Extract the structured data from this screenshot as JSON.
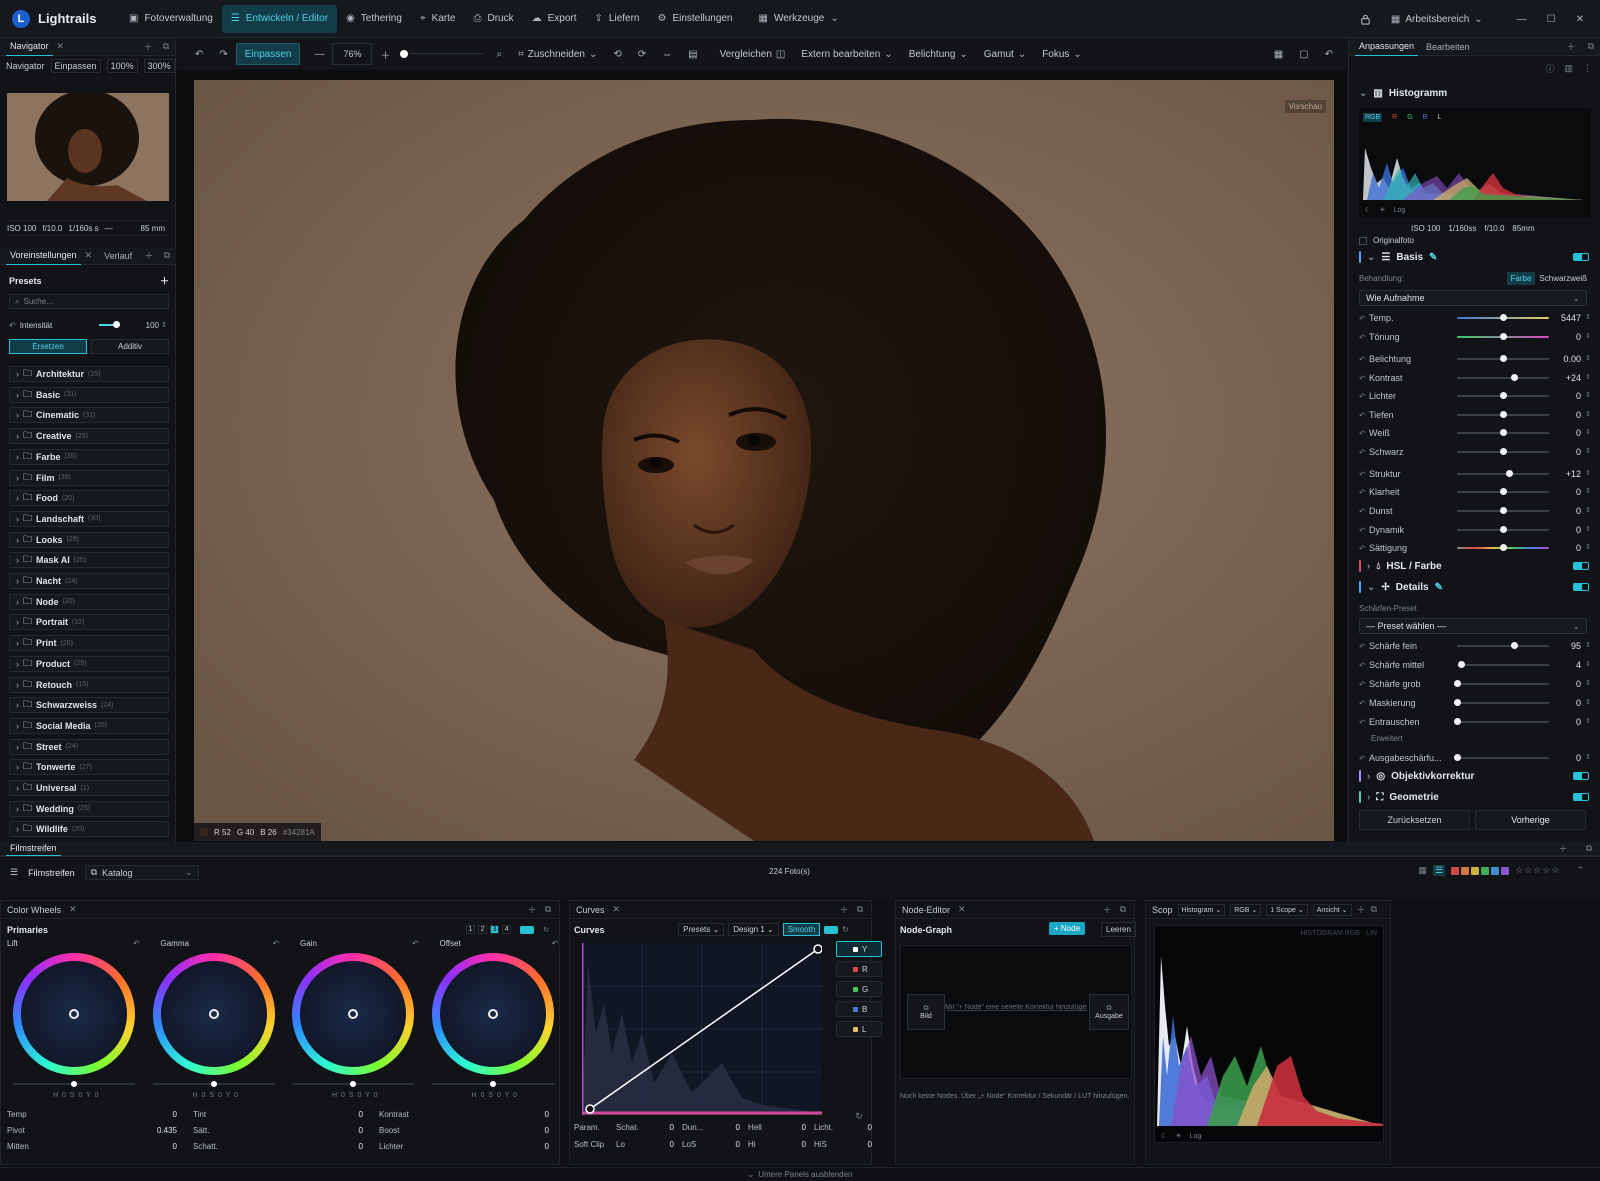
{
  "app": {
    "name": "Lightrails"
  },
  "topnav": [
    {
      "label": "Fotoverwaltung",
      "icon": "photos-icon",
      "active": false
    },
    {
      "label": "Entwickeln / Editor",
      "icon": "sliders-icon",
      "active": true
    },
    {
      "label": "Tethering",
      "icon": "camera-icon",
      "active": false
    },
    {
      "label": "Karte",
      "icon": "map-pin-icon",
      "active": false
    },
    {
      "label": "Druck",
      "icon": "printer-icon",
      "active": false
    },
    {
      "label": "Export",
      "icon": "cloud-upload-icon",
      "active": false
    },
    {
      "label": "Liefern",
      "icon": "upload-icon",
      "active": false
    },
    {
      "label": "Einstellungen",
      "icon": "gear-icon",
      "active": false
    },
    {
      "label": "Werkzeuge",
      "icon": "grid-icon",
      "active": false
    }
  ],
  "topright": {
    "workspace": "Arbeitsbereich"
  },
  "navigator": {
    "tab": "Navigator",
    "label": "Navigator",
    "fit": "Einpassen",
    "z100": "100%",
    "z300": "300%",
    "exif": [
      "ISO 100",
      "f/10.0",
      "1/160s s",
      "—",
      "85 mm"
    ]
  },
  "presets_panel": {
    "tab1": "Voreinstellungen",
    "tab2": "Verlauf",
    "title": "Presets",
    "search_placeholder": "Suche...",
    "intensity_label": "Intensität",
    "intensity_value": "100",
    "intensity": 1.0,
    "mode_replace": "Ersetzen",
    "mode_additive": "Additiv",
    "folders": [
      {
        "name": "Architektur",
        "count": "(25)"
      },
      {
        "name": "Basic",
        "count": "(31)"
      },
      {
        "name": "Cinematic",
        "count": "(31)"
      },
      {
        "name": "Creative",
        "count": "(25)"
      },
      {
        "name": "Farbe",
        "count": "(35)"
      },
      {
        "name": "Film",
        "count": "(39)"
      },
      {
        "name": "Food",
        "count": "(20)"
      },
      {
        "name": "Landschaft",
        "count": "(30)"
      },
      {
        "name": "Looks",
        "count": "(29)"
      },
      {
        "name": "Mask AI",
        "count": "(25)"
      },
      {
        "name": "Nacht",
        "count": "(24)"
      },
      {
        "name": "Node",
        "count": "(20)"
      },
      {
        "name": "Portrait",
        "count": "(32)"
      },
      {
        "name": "Print",
        "count": "(20)"
      },
      {
        "name": "Product",
        "count": "(25)"
      },
      {
        "name": "Retouch",
        "count": "(15)"
      },
      {
        "name": "Schwarzweiss",
        "count": "(24)"
      },
      {
        "name": "Social Media",
        "count": "(20)"
      },
      {
        "name": "Street",
        "count": "(24)"
      },
      {
        "name": "Tonwerte",
        "count": "(27)"
      },
      {
        "name": "Universal",
        "count": "(1)"
      },
      {
        "name": "Wedding",
        "count": "(25)"
      },
      {
        "name": "Wildlife",
        "count": "(20)"
      }
    ]
  },
  "toolbar": {
    "fit": "Einpassen",
    "zoom": "76%",
    "crop": "Zuschneiden",
    "compare": "Vergleichen",
    "external": "Extern bearbeiten",
    "exposure": "Belichtung",
    "gamut": "Gamut",
    "focus": "Fokus"
  },
  "viewer": {
    "preview_badge": "Vorschau",
    "pixel_readout": {
      "r": "R 52",
      "g": "G 40",
      "b": "B 26",
      "hex": "#34281A"
    }
  },
  "right_panel": {
    "tab1": "Anpassungen",
    "tab2": "Bearbeiten",
    "histogram_title": "Histogramm",
    "hist_channels": [
      "RGB",
      "R",
      "G",
      "B",
      "L"
    ],
    "hist_log": "Log",
    "exif_line": [
      "ISO 100",
      "1/160ss",
      "f/10.0",
      "85mm"
    ],
    "original_label": "Originalfoto",
    "basis": {
      "title": "Basis",
      "treatment_label": "Behandlung:",
      "treatment_color": "Farbe",
      "treatment_bw": "Schwarzweiß",
      "profile": "Wie Aufnahme",
      "sliders": [
        {
          "label": "Temp.",
          "value": "5447",
          "pos": 0.5,
          "gradient": "temp"
        },
        {
          "label": "Tönung",
          "value": "0",
          "pos": 0.5,
          "gradient": "tint"
        },
        {
          "label": "Belichtung",
          "value": "0.00",
          "pos": 0.5
        },
        {
          "label": "Kontrast",
          "value": "+24",
          "pos": 0.62
        },
        {
          "label": "Lichter",
          "value": "0",
          "pos": 0.5
        },
        {
          "label": "Tiefen",
          "value": "0",
          "pos": 0.5
        },
        {
          "label": "Weiß",
          "value": "0",
          "pos": 0.5
        },
        {
          "label": "Schwarz",
          "value": "0",
          "pos": 0.5
        },
        {
          "label": "Struktur",
          "value": "+12",
          "pos": 0.56
        },
        {
          "label": "Klarheit",
          "value": "0",
          "pos": 0.5
        },
        {
          "label": "Dunst",
          "value": "0",
          "pos": 0.5
        },
        {
          "label": "Dynamik",
          "value": "0",
          "pos": 0.5
        },
        {
          "label": "Sättigung",
          "value": "0",
          "pos": 0.5,
          "gradient": "sat"
        }
      ]
    },
    "hsl_title": "HSL / Farbe",
    "details": {
      "title": "Details",
      "preset_label": "Schärfen-Preset",
      "preset_value": "— Preset wählen —",
      "sliders": [
        {
          "label": "Schärfe fein",
          "value": "95",
          "pos": 0.62
        },
        {
          "label": "Schärfe mittel",
          "value": "4",
          "pos": 0.04
        },
        {
          "label": "Schärfe grob",
          "value": "0",
          "pos": 0.0
        },
        {
          "label": "Maskierung",
          "value": "0",
          "pos": 0.0
        },
        {
          "label": "Entrauschen",
          "value": "0",
          "pos": 0.0
        }
      ],
      "advanced": "Erweitert",
      "output": {
        "label": "Ausgabeschärfu...",
        "value": "0",
        "pos": 0.0
      }
    },
    "lens_title": "Objektivkorrektur",
    "geometry_title": "Geometrie",
    "reset": "Zurücksetzen",
    "previous": "Vorherige"
  },
  "filmstrip": {
    "tab": "Filmstreifen",
    "label": "Filmstreifen",
    "catalog": "Katalog",
    "count": "224 Foto(s)",
    "swatches": [
      "#d04848",
      "#d07a3c",
      "#c9b040",
      "#3fae5a",
      "#3f8fd0",
      "#8a55c8"
    ]
  },
  "color_wheels": {
    "tab": "Color Wheels",
    "primaries": "Primaries",
    "pages": [
      "1",
      "2",
      "3",
      "4"
    ],
    "active_page": "3",
    "wheels": [
      {
        "label": "Lift",
        "hsy": "H 0 S 0 Y 0"
      },
      {
        "label": "Gamma",
        "hsy": "H 0 S 0 Y 0"
      },
      {
        "label": "Gain",
        "hsy": "H 0 S 0 Y 0"
      },
      {
        "label": "Offset",
        "hsy": "H 0 S 0 Y 0"
      }
    ],
    "params": [
      [
        {
          "k": "Temp",
          "v": "0"
        },
        {
          "k": "Tint",
          "v": "0"
        },
        {
          "k": "Kontrast",
          "v": "0"
        }
      ],
      [
        {
          "k": "Pivot",
          "v": "0.435"
        },
        {
          "k": "Sätt.",
          "v": "0"
        },
        {
          "k": "Boost",
          "v": "0"
        }
      ],
      [
        {
          "k": "Mitten",
          "v": "0"
        },
        {
          "k": "Schatt.",
          "v": "0"
        },
        {
          "k": "Lichter",
          "v": "0"
        }
      ]
    ]
  },
  "curves": {
    "tab": "Curves",
    "title": "Curves",
    "presets": "Presets",
    "design": "Design 1",
    "smooth": "Smooth",
    "channels": [
      "Y",
      "R",
      "G",
      "B",
      "L"
    ],
    "params": [
      [
        {
          "k": "Param.",
          "v": ""
        },
        {
          "k": "Schat.",
          "v": "0"
        },
        {
          "k": "Dun...",
          "v": "0"
        },
        {
          "k": "Hell",
          "v": "0"
        },
        {
          "k": "Licht.",
          "v": "0"
        }
      ],
      [
        {
          "k": "Soft Clip",
          "v": ""
        },
        {
          "k": "Lo",
          "v": "0"
        },
        {
          "k": "LoS",
          "v": "0"
        },
        {
          "k": "Hi",
          "v": "0"
        },
        {
          "k": "HiS",
          "v": "0"
        }
      ]
    ]
  },
  "node_editor": {
    "tab": "Node-Editor",
    "title": "Node-Graph",
    "add": "+ Node",
    "clear": "Leeren",
    "input": "Bild",
    "output": "Ausgabe",
    "hint_line": "Mit \"+ Node\" eine serielle Korrektur hinzufügen",
    "empty_text": "Noch keine Nodes. Über „+ Node\" Korrektur / Sekundär / LUT hinzufügen."
  },
  "scope": {
    "tab": "Scop",
    "type": "Histogram",
    "mode": "RGB",
    "count": "1 Scope",
    "view": "Ansicht",
    "overlay": "HISTOGRAM RGB · LIN",
    "log": "Log"
  },
  "footer": {
    "hide_panels": "Untere Panels ausblenden"
  },
  "colors": {
    "accent": "#27c2d6",
    "accent_dark": "#123c48",
    "panel": "#111317",
    "bg": "#0e1013"
  }
}
